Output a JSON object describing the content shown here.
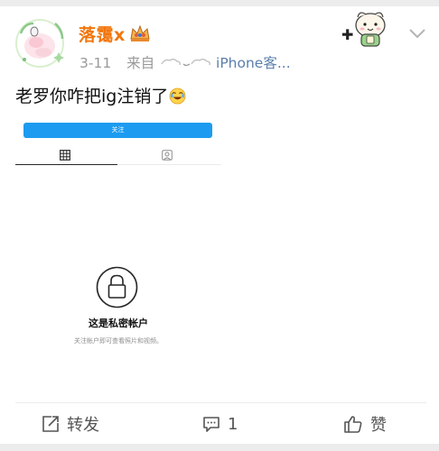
{
  "post": {
    "username": "落霭x",
    "date": "3-11",
    "source_prefix": "来自",
    "source_name": "iPhone客...",
    "text": "老罗你咋把ig注销了"
  },
  "instagram_screenshot": {
    "follow_label": "关注",
    "private_title": "这是私密帐户",
    "private_subtitle": "关注帐户即可查看照片和视频。"
  },
  "actions": {
    "repost_label": "转发",
    "comment_count": "1",
    "like_label": "赞"
  },
  "colors": {
    "username": "#f2760d",
    "follow_button": "#1d9bf0",
    "source_link": "#5b7fab",
    "meta_gray": "#9a9a9a"
  },
  "icons": [
    "avatar",
    "crown-badge-icon",
    "sticker-decoration",
    "chevron-down-icon",
    "cloud-icon",
    "laughing-emoji",
    "grid-icon",
    "tagged-icon",
    "lock-icon",
    "repost-icon",
    "comment-icon",
    "like-icon"
  ]
}
